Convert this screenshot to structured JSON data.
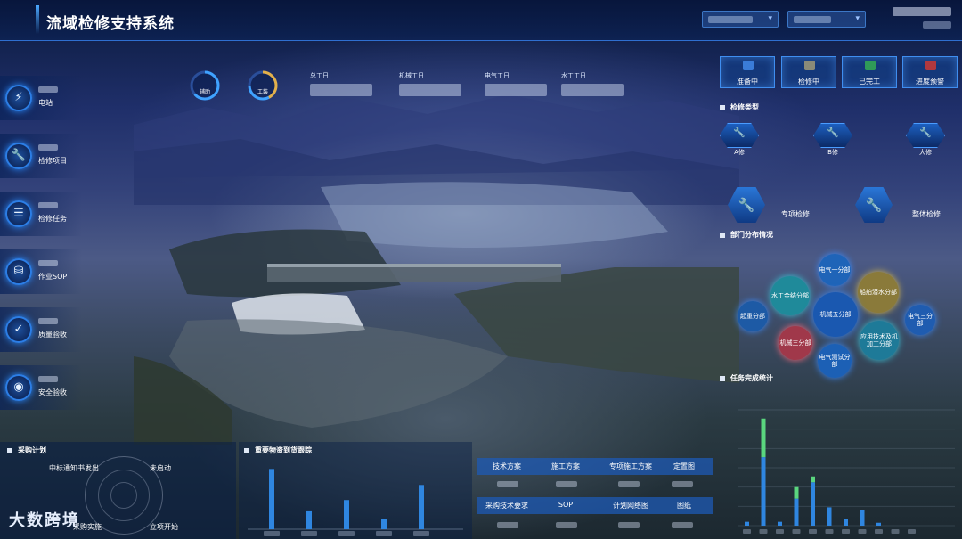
{
  "app": {
    "title": "流域检修支持系统"
  },
  "header": {
    "user_initial": ""
  },
  "sidebar": {
    "items": [
      {
        "label": "电站",
        "icon": "power-station-icon",
        "glyph": "⚡"
      },
      {
        "label": "检修项目",
        "icon": "wrench-icon",
        "glyph": "🔧"
      },
      {
        "label": "检修任务",
        "icon": "task-document-icon",
        "glyph": "☰"
      },
      {
        "label": "作业SOP",
        "icon": "sop-icon",
        "glyph": "⛁"
      },
      {
        "label": "质量验收",
        "icon": "quality-shield-icon",
        "glyph": "✓"
      },
      {
        "label": "安全验收",
        "icon": "safety-shield-icon",
        "glyph": "◉"
      }
    ]
  },
  "top_stats": {
    "gauges": [
      {
        "label": "辅助"
      },
      {
        "label": "工装"
      }
    ],
    "items": [
      {
        "label": "总工日"
      },
      {
        "label": "机械工日"
      },
      {
        "label": "电气工日"
      },
      {
        "label": "水工工日"
      }
    ]
  },
  "status_buttons": [
    {
      "label": "准备中",
      "color": "#3a7cd8"
    },
    {
      "label": "检修中",
      "color": "#8a8a78"
    },
    {
      "label": "已完工",
      "color": "#2f9a58"
    },
    {
      "label": "进度预警",
      "color": "#b0383e"
    }
  ],
  "repair_types": {
    "title": "检修类型",
    "kinds": [
      {
        "label": "A修"
      },
      {
        "label": "B修"
      },
      {
        "label": "大修"
      }
    ],
    "modes": [
      {
        "label": "专项检修"
      },
      {
        "label": "整体检修"
      }
    ]
  },
  "dept": {
    "title": "部门分布情况",
    "bubbles": [
      {
        "label": "电气一分部",
        "color": "#1f64b8"
      },
      {
        "label": "水工金结分部",
        "color": "#1f8a9a"
      },
      {
        "label": "船舶潜水分部",
        "color": "#8a7a3a"
      },
      {
        "label": "机械五分部",
        "color": "#1a58b0"
      },
      {
        "label": "起重分部",
        "color": "#1d5aa5"
      },
      {
        "label": "电气三分部",
        "color": "#1f5cb0"
      },
      {
        "label": "机械三分部",
        "color": "#a0384a"
      },
      {
        "label": "应用技术及机加工分部",
        "color": "#1e7a98"
      },
      {
        "label": "电气测试分部",
        "color": "#1c60b5"
      }
    ]
  },
  "task_stats": {
    "title": "任务完成统计"
  },
  "procurement": {
    "title": "采购计划",
    "rows": [
      {
        "left": "中标通知书发出",
        "right": "未启动"
      },
      {
        "left": "采购实施",
        "right": "立项开始"
      }
    ]
  },
  "materials": {
    "title": "重要物资到货跟踪"
  },
  "sop_table": {
    "head1": [
      "技术方案",
      "施工方案",
      "专项施工方案",
      "定置图"
    ],
    "head2": [
      "采购技术要求",
      "SOP",
      "计划网络图",
      "图纸"
    ]
  },
  "logo": {
    "text": "大数跨境"
  },
  "colors": {
    "accent": "#2f7fe8",
    "bar_blue": "#2f86e0",
    "bar_green": "#5ad67e"
  },
  "chart_data": [
    {
      "type": "bar",
      "name": "materials-tracking",
      "categories": [
        "",
        "",
        "",
        "",
        ""
      ],
      "values": [
        64,
        19,
        31,
        11,
        47
      ],
      "ylim": [
        0,
        70
      ]
    },
    {
      "type": "bar",
      "name": "task-completion",
      "categories": [
        "",
        "",
        "",
        "",
        "",
        "",
        "",
        "",
        "",
        "",
        ""
      ],
      "series": [
        {
          "values": [
            4,
            71,
            4,
            28,
            45,
            19,
            7,
            16,
            3,
            0,
            0
          ]
        },
        {
          "values": [
            0,
            40,
            0,
            12,
            6,
            0,
            0,
            0,
            0,
            0,
            0
          ]
        }
      ],
      "ylim": [
        0,
        120
      ]
    }
  ]
}
